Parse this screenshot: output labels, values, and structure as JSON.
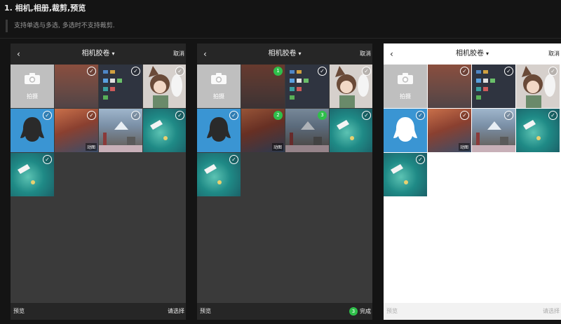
{
  "doc": {
    "heading": "1. 相机,相册,裁剪,预览",
    "note": "支持单选与多选, 多选时不支持裁剪."
  },
  "panels": [
    {
      "theme": "dark",
      "header": {
        "back": "‹",
        "title": "相机胶卷",
        "caret": "▾",
        "cancel": "取消"
      },
      "camera_label": "拍摄",
      "gif_label": "动图",
      "footer": {
        "preview": "预览",
        "action": "请选择"
      }
    },
    {
      "theme": "dark",
      "header": {
        "back": "‹",
        "title": "相机胶卷",
        "caret": "▾",
        "cancel": "取消"
      },
      "camera_label": "拍摄",
      "gif_label": "动图",
      "selection_numbers": [
        "1",
        "2",
        "3"
      ],
      "footer": {
        "preview": "预览",
        "done_count": "3",
        "action": "完成"
      }
    },
    {
      "theme": "light",
      "header": {
        "back": "‹",
        "title": "相机胶卷",
        "caret": "▾",
        "cancel": "取消"
      },
      "camera_label": "拍摄",
      "gif_label": "动图",
      "footer": {
        "preview": "预览",
        "action": "请选择"
      }
    }
  ],
  "colors": {
    "selected_badge": "#2fbf4a",
    "avatar_blue": "#3a95d3"
  },
  "icons": {
    "check": "✓",
    "camera": "camera-icon"
  }
}
